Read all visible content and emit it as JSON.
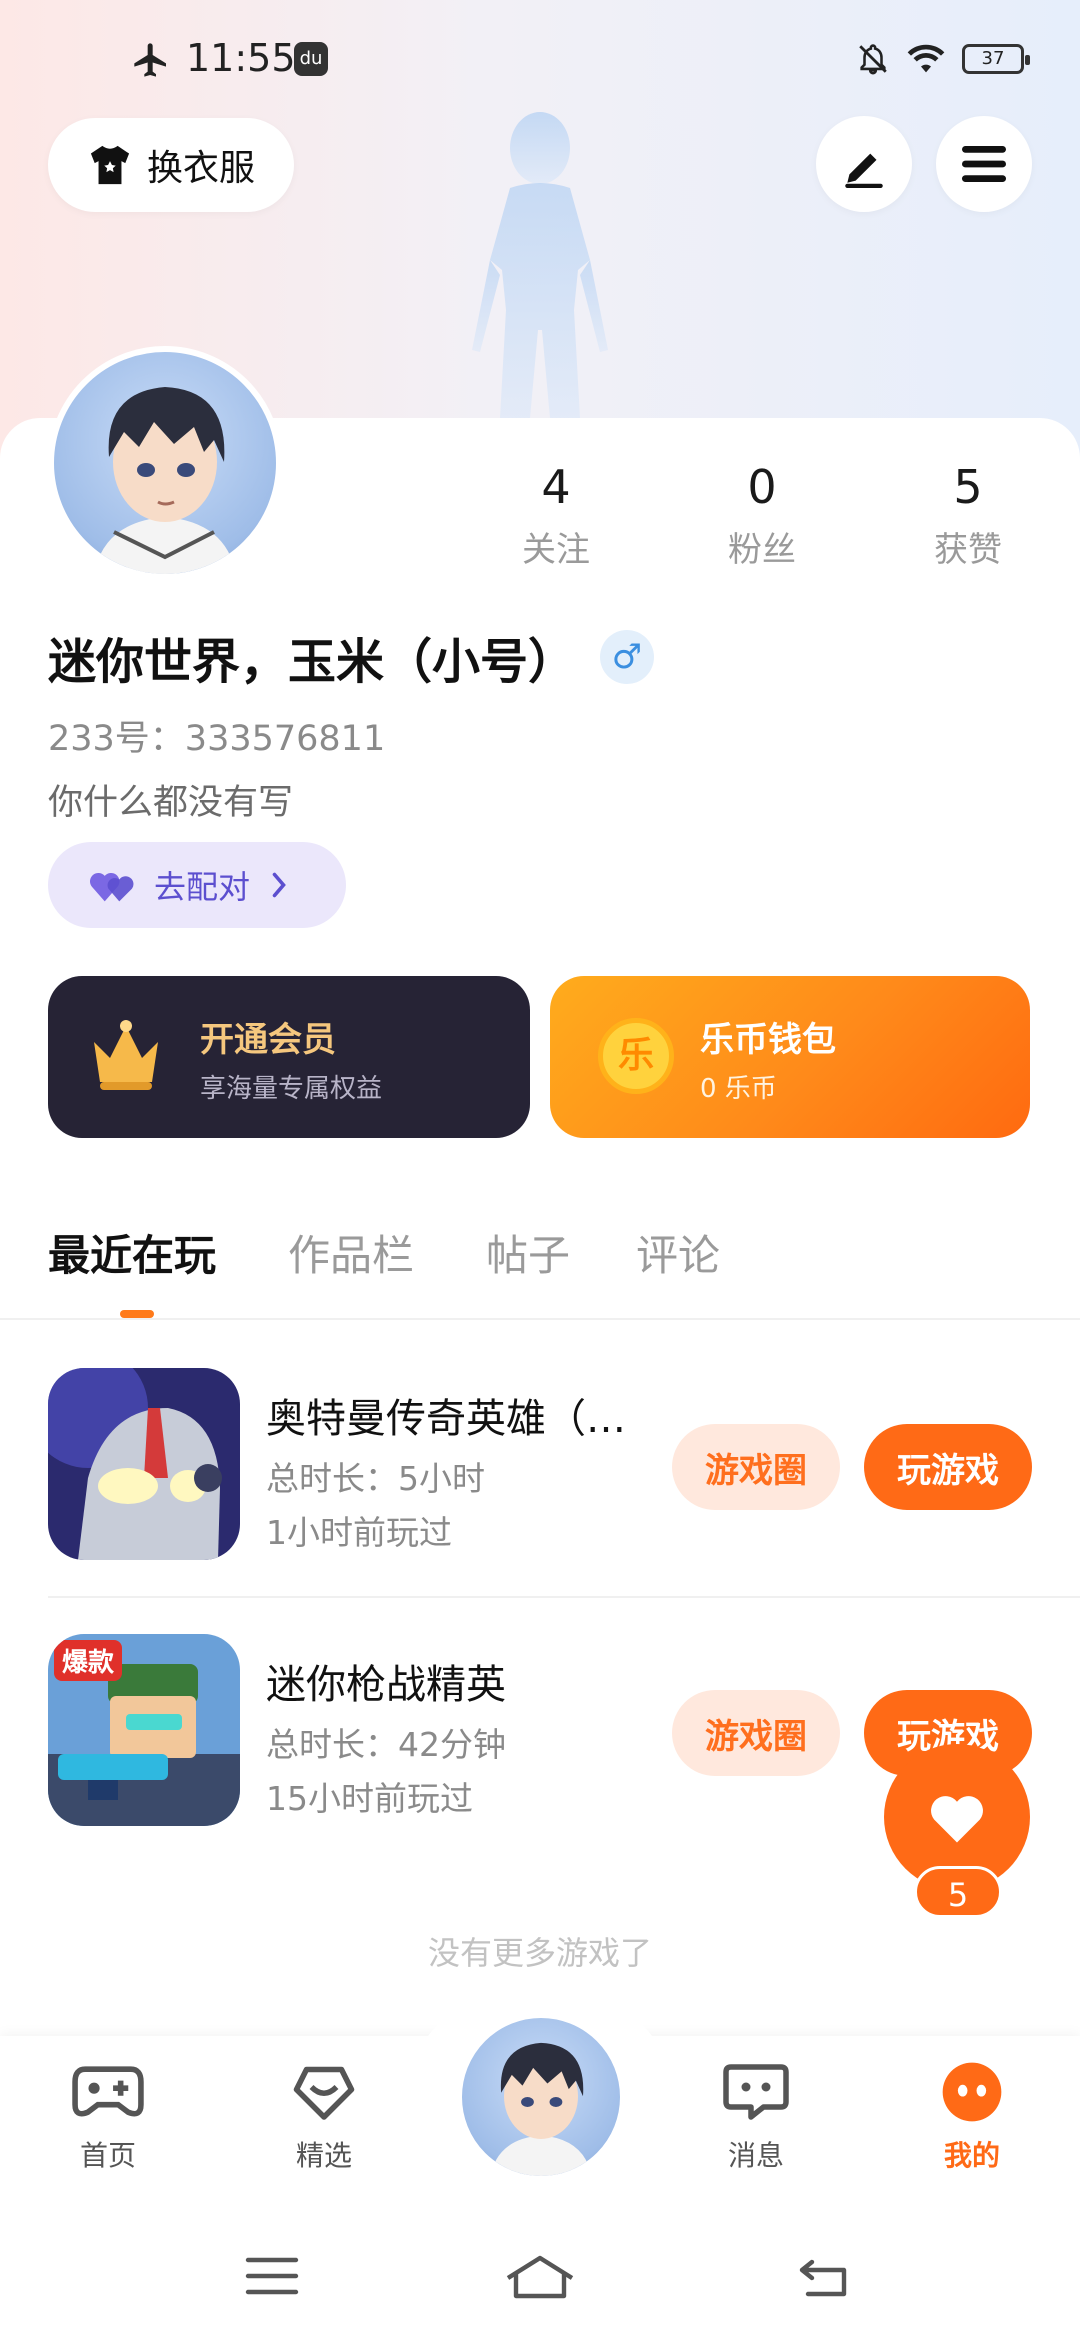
{
  "status_bar": {
    "time": "11:55",
    "app_icon_text": "du",
    "battery": "37"
  },
  "header": {
    "dress_button": "换衣服"
  },
  "profile": {
    "stats": [
      {
        "value": "4",
        "label": "关注"
      },
      {
        "value": "0",
        "label": "粉丝"
      },
      {
        "value": "5",
        "label": "获赞"
      }
    ],
    "name": "迷你世界，玉米（小号）",
    "gender_symbol": "♂",
    "uid": "233号：333576811",
    "bio": "你什么都没有写",
    "match_button": "去配对"
  },
  "cards": {
    "vip": {
      "title": "开通会员",
      "subtitle": "享海量专属权益"
    },
    "wallet": {
      "title": "乐币钱包",
      "subtitle": "0 乐币",
      "coin_glyph": "乐"
    }
  },
  "tabs": [
    {
      "label": "最近在玩",
      "active": true
    },
    {
      "label": "作品栏",
      "active": false
    },
    {
      "label": "帖子",
      "active": false
    },
    {
      "label": "评论",
      "active": false
    }
  ],
  "games": [
    {
      "title": "奥特曼传奇英雄（…",
      "duration": "总时长：5小时",
      "last_played": "1小时前玩过",
      "circle_label": "游戏圈",
      "play_label": "玩游戏"
    },
    {
      "title": "迷你枪战精英",
      "duration": "总时长：42分钟",
      "last_played": "15小时前玩过",
      "circle_label": "游戏圈",
      "play_label": "玩游戏",
      "badge_text": "爆款"
    }
  ],
  "no_more_text": "没有更多游戏了",
  "like_count": "5",
  "bottom_nav": [
    {
      "label": "首页"
    },
    {
      "label": "精选"
    },
    {
      "label": "消息"
    },
    {
      "label": "我的",
      "active": true
    }
  ],
  "colors": {
    "accent": "#ff6a16",
    "vip_bg": "#262335",
    "vip_text": "#f5c77e",
    "match_bg": "#ebe7fb",
    "match_text": "#5c4fcf"
  }
}
